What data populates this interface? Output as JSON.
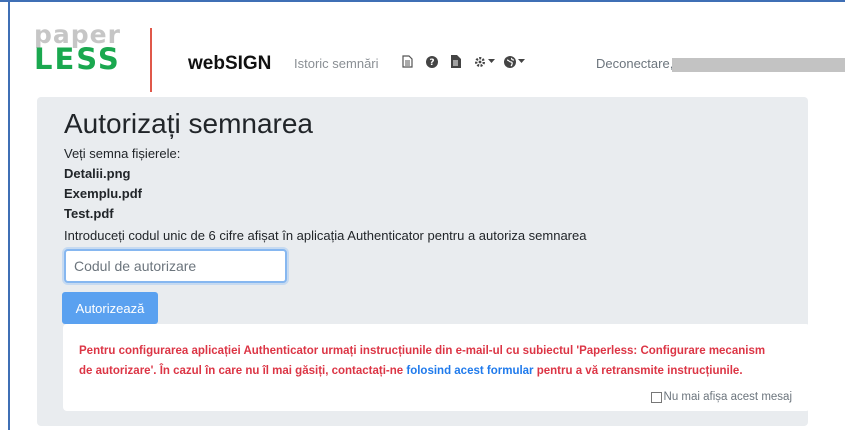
{
  "logo": {
    "top": "paper",
    "bottom": "LESS"
  },
  "nav": {
    "brand": "webSIGN",
    "history_link": "Istoric semnări",
    "icons": [
      "document-icon",
      "help-icon",
      "file-icon",
      "settings-icon",
      "globe-icon"
    ],
    "logout": "Deconectare,"
  },
  "page": {
    "title": "Autorizați semnarea",
    "intro": "Veți semna fișierele:",
    "files": [
      "Detalii.png",
      "Exemplu.pdf",
      "Test.pdf"
    ],
    "instructions": "Introduceți codul unic de 6 cifre afișat în aplicația Authenticator pentru a autoriza semnarea",
    "code_placeholder": "Codul de autorizare",
    "code_value": "",
    "authorize_button": "Autorizează"
  },
  "alert": {
    "text_before": "Pentru configurarea aplicației Authenticator urmați instrucțiunile din e-mail-ul cu subiectul 'Paperless: Configurare mecanism de autorizare'. În cazul în care nu îl mai găsiți, contactați-ne ",
    "link": "folosind acest formular",
    "text_after": " pentru a vă retransmite instrucțiunile.",
    "dismiss_label": "Nu mai afișa acest mesaj",
    "dismiss_checked": false
  },
  "colors": {
    "accent": "#5aa1f0",
    "alert": "#dc3545",
    "link": "#1f7aec",
    "logo_green": "#1aa84f",
    "logo_grey": "#c6c6c6",
    "divider": "#e0584a"
  }
}
